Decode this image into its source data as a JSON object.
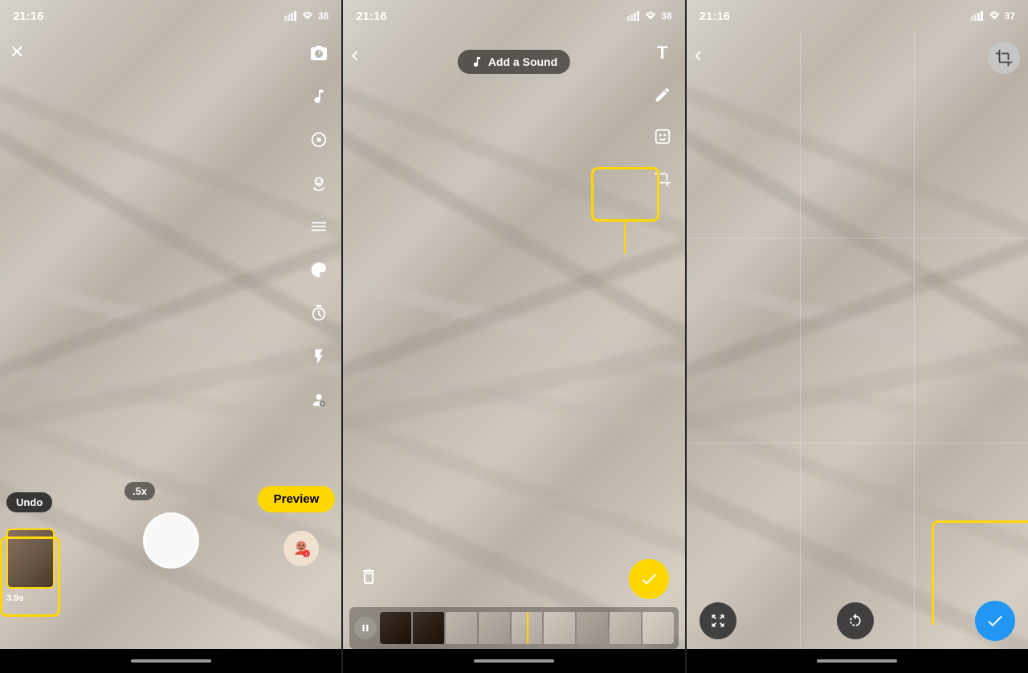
{
  "panels": {
    "panel1": {
      "status_time": "21:16",
      "battery": "38",
      "close_icon": "✕",
      "camera_flip_icon": "⟳",
      "music_icon": "♪",
      "photo_icon": "⬡",
      "face_icon": "◉",
      "scissors_icon": "✂",
      "palette_icon": "🎨",
      "timer_icon": "◷",
      "lightning_icon": "⚡",
      "bitmoji_icon": "😊",
      "zoom_label": ".5x",
      "undo_label": "Undo",
      "preview_label": "Preview",
      "duration_label": "3.9s"
    },
    "panel2": {
      "status_time": "21:16",
      "battery": "38",
      "back_icon": "‹",
      "add_sound_label": "Add a Sound",
      "music_note": "♫",
      "text_icon": "T",
      "draw_icon": "✏",
      "sticker_icon": "◻",
      "crop_icon": "⊡",
      "delete_icon": "🗑",
      "check_icon": "✓",
      "play_icon": "⏸"
    },
    "panel3": {
      "status_time": "21:16",
      "battery": "37",
      "back_icon": "‹",
      "crop_icon": "⊡",
      "expand_icon": "⤡",
      "rotate_icon": "↺",
      "check_icon": "✓"
    }
  },
  "colors": {
    "yellow": "#FFD700",
    "blue": "#2196F3",
    "dark_bg": "#000000",
    "white": "#ffffff",
    "dark_control": "rgba(50,50,50,0.9)"
  }
}
